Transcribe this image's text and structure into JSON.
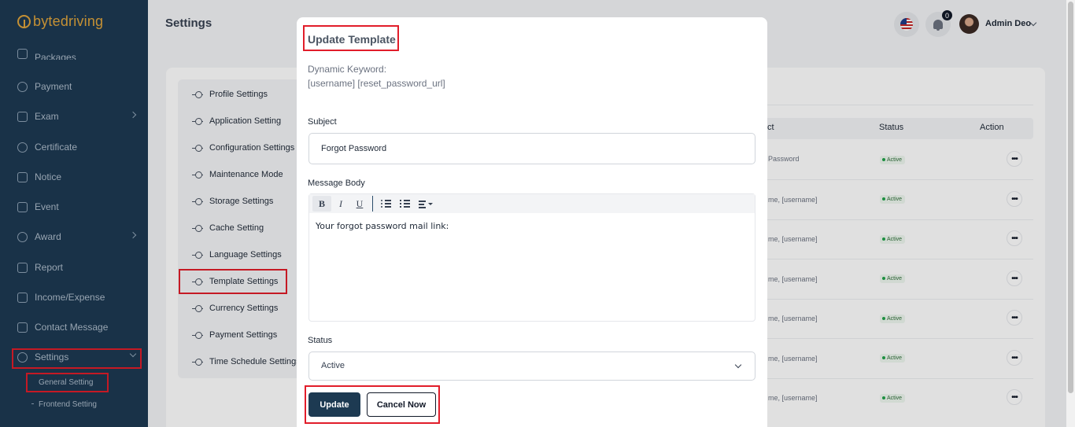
{
  "app": {
    "logo_text": "bytedriving"
  },
  "sidebar": {
    "items": [
      {
        "label": "Packages",
        "icon": "package-icon"
      },
      {
        "label": "Payment",
        "icon": "payment-icon"
      },
      {
        "label": "Exam",
        "icon": "exam-icon"
      },
      {
        "label": "Certificate",
        "icon": "certificate-icon"
      },
      {
        "label": "Notice",
        "icon": "notice-icon"
      },
      {
        "label": "Event",
        "icon": "calendar-icon"
      },
      {
        "label": "Award",
        "icon": "award-icon"
      },
      {
        "label": "Report",
        "icon": "report-icon"
      },
      {
        "label": "Income/Expense",
        "icon": "wallet-icon"
      },
      {
        "label": "Contact Message",
        "icon": "message-icon"
      },
      {
        "label": "Settings",
        "icon": "gear-icon"
      }
    ],
    "sub_items": [
      {
        "label": "General Setting"
      },
      {
        "label": "Frontend Setting"
      }
    ]
  },
  "header": {
    "title": "Settings",
    "notification_count": "0",
    "user_name": "Admin Deo"
  },
  "settings_list": [
    "Profile Settings",
    "Application Setting",
    "Configuration Settings",
    "Maintenance Mode",
    "Storage Settings",
    "Cache Setting",
    "Language Settings",
    "Template Settings",
    "Currency Settings",
    "Payment Settings",
    "Time Schedule Settings"
  ],
  "table": {
    "headers": {
      "subject": "ct",
      "status": "Status",
      "action": "Action"
    },
    "rows": [
      {
        "subject": "Password",
        "status": "Active"
      },
      {
        "subject": "me, [username]",
        "status": "Active"
      },
      {
        "subject": "me, [username]",
        "status": "Active"
      },
      {
        "subject": "me, [username]",
        "status": "Active"
      },
      {
        "subject": "me, [username]",
        "status": "Active"
      },
      {
        "subject": "me, [username]",
        "status": "Active"
      },
      {
        "subject": "me, [username]",
        "status": "Active"
      }
    ],
    "action_label": "•••"
  },
  "modal": {
    "title": "Update Template",
    "keyword_label": "Dynamic Keyword:",
    "keyword_value": "[username] [reset_password_url]",
    "subject_label": "Subject",
    "subject_value": "Forgot Password",
    "body_label": "Message Body",
    "toolbar": {
      "bold": "B",
      "italic": "I",
      "underline": "U"
    },
    "body_text": "Your forgot password mail link:",
    "status_label": "Status",
    "status_value": "Active",
    "update_label": "Update",
    "cancel_label": "Cancel Now"
  },
  "colors": {
    "sidebar_bg": "#1d3a52",
    "logo": "#e0a43c",
    "highlight": "#e11d2a",
    "primary_button": "#1d3a52",
    "status_active": "#22a34a"
  }
}
